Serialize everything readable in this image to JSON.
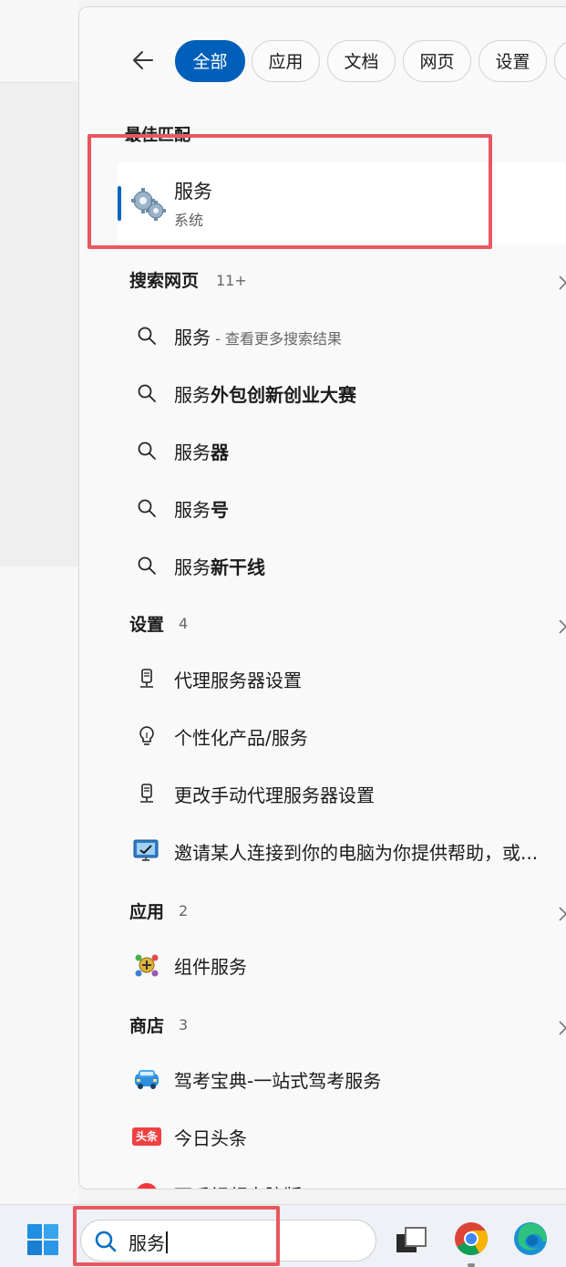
{
  "filters": {
    "chips": [
      {
        "label": "全部",
        "active": true
      },
      {
        "label": "应用",
        "active": false
      },
      {
        "label": "文档",
        "active": false
      },
      {
        "label": "网页",
        "active": false
      },
      {
        "label": "设置",
        "active": false
      }
    ]
  },
  "best_match": {
    "header": "最佳匹配",
    "title": "服务",
    "subtitle": "系统",
    "icon": "gears-icon"
  },
  "web_search": {
    "header": "搜索网页",
    "count": "11+",
    "items": [
      {
        "prefix": "服务",
        "bold": "",
        "hint": " - 查看更多搜索结果"
      },
      {
        "prefix": "服务",
        "bold": "外包创新创业大赛",
        "hint": ""
      },
      {
        "prefix": "服务",
        "bold": "器",
        "hint": ""
      },
      {
        "prefix": "服务",
        "bold": "号",
        "hint": ""
      },
      {
        "prefix": "服务",
        "bold": "新干线",
        "hint": ""
      }
    ]
  },
  "settings": {
    "header": "设置",
    "count": "4",
    "items": [
      {
        "label": "代理服务器设置",
        "icon": "proxy-icon"
      },
      {
        "label": "个性化产品/服务",
        "icon": "lightbulb-icon"
      },
      {
        "label": "更改手动代理服务器设置",
        "icon": "proxy-icon"
      },
      {
        "label": "邀请某人连接到你的电脑为你提供帮助，或...",
        "icon": "remote-assistance-icon"
      }
    ]
  },
  "apps": {
    "header": "应用",
    "count": "2",
    "items": [
      {
        "label": "组件服务",
        "icon": "component-services-icon"
      }
    ]
  },
  "store": {
    "header": "商店",
    "count": "3",
    "items": [
      {
        "label": "驾考宝典-一站式驾考服务",
        "icon": "car-icon"
      },
      {
        "label": "今日头条",
        "icon": "toutiao-icon",
        "badge": "头条"
      },
      {
        "label": "西瓜视频电脑版",
        "icon": "watermelon-video-icon"
      }
    ]
  },
  "taskbar": {
    "search_value": "服务",
    "apps": [
      "task-view-icon",
      "chrome-icon",
      "edge-icon"
    ]
  },
  "colors": {
    "accent": "#005fb8",
    "highlight": "#e8585f",
    "panel": "#f9f9f9"
  }
}
